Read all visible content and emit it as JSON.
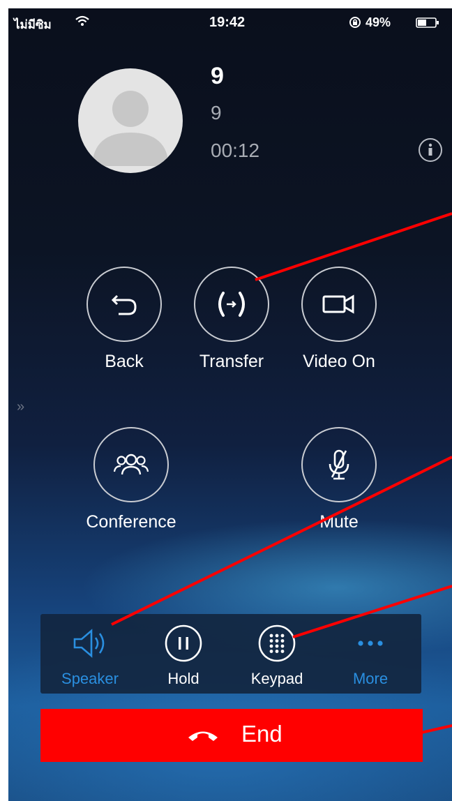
{
  "status_bar": {
    "carrier": "ไม่มีซิม",
    "time": "19:42",
    "battery_percent": "49%"
  },
  "caller": {
    "name": "9",
    "number": "9",
    "duration": "00:12"
  },
  "actions": {
    "back": "Back",
    "transfer": "Transfer",
    "video_on": "Video On",
    "conference": "Conference",
    "mute": "Mute"
  },
  "toolbar": {
    "speaker": "Speaker",
    "hold": "Hold",
    "keypad": "Keypad",
    "more": "More"
  },
  "end_call": {
    "label": "End"
  },
  "colors": {
    "accent_blue": "#2a8fe0",
    "end_red": "#ff0000",
    "annotation_red": "#ff0000"
  },
  "icons": [
    "wifi-icon",
    "rotation-lock-icon",
    "battery-icon",
    "avatar-silhouette",
    "info-icon",
    "back-arrow-icon",
    "transfer-icon",
    "video-camera-icon",
    "conference-icon",
    "muted-microphone-icon",
    "speaker-icon",
    "pause-icon",
    "keypad-icon",
    "more-dots-icon",
    "hang-up-icon"
  ]
}
